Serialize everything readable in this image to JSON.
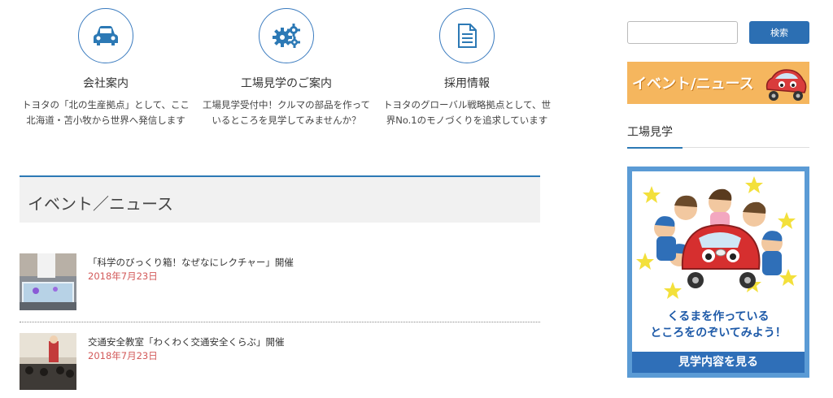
{
  "features": [
    {
      "icon": "car-icon",
      "title": "会社案内",
      "desc": "トヨタの「北の生産拠点」として、ここ北海道・苫小牧から世界へ発信します"
    },
    {
      "icon": "gears-icon",
      "title": "工場見学のご案内",
      "desc": "工場見学受付中！クルマの部品を作っているところを見学してみませんか？"
    },
    {
      "icon": "document-icon",
      "title": "採用情報",
      "desc": "トヨタのグローバル戦略拠点として、世界No.1のモノづくりを追求しています"
    }
  ],
  "section": {
    "title": "イベント／ニュース"
  },
  "news": [
    {
      "title": "「科学のびっくり箱！なぜなにレクチャー」開催",
      "date": "2018年7月23日"
    },
    {
      "title": "交通安全教室「わくわく交通安全くらぶ」開催",
      "date": "2018年7月23日"
    }
  ],
  "sidebar": {
    "search_button": "検索",
    "search_placeholder": "",
    "event_banner": "イベント/ニュース",
    "widget_title": "工場見学",
    "tour_line1": "くるまを作っている",
    "tour_line2": "ところをのぞいてみよう！",
    "tour_button": "見学内容を見る"
  }
}
